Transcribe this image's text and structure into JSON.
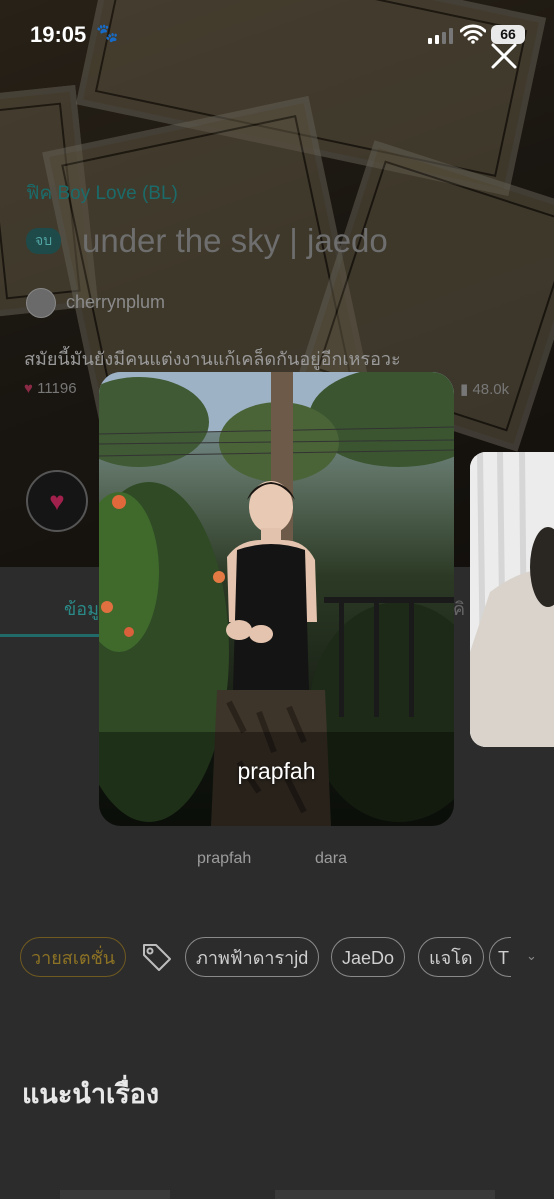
{
  "status_bar": {
    "time": "19:05",
    "battery": "66"
  },
  "story": {
    "genre": "ฟิค Boy Love (BL)",
    "status_badge": "จบ",
    "title": "under the sky | jaedo",
    "author": "cherrynplum",
    "description": "สมัยนี้มันยังมีคนแต่งงานแก้เคล็ดกันอยู่อีกเหรอวะ",
    "likes": "11196",
    "reads": "48.0k"
  },
  "tabs": {
    "info": "ข้อมูล",
    "other": "คิ"
  },
  "characters": [
    {
      "name": "prapfah"
    },
    {
      "name": "dara"
    }
  ],
  "tags": [
    "วายสเตชั่น",
    "ภาพฟ้าดาราjd",
    "JaeDo",
    "แจโด",
    "T"
  ],
  "section": {
    "recommend_title": "แนะนำเรื่อง"
  },
  "overlay": {
    "current_label": "prapfah"
  },
  "icons": {
    "close": "close-icon",
    "heart": "heart-icon",
    "tag": "tag-icon",
    "paw": "paw-icon",
    "signal": "cellular-signal-icon",
    "wifi": "wifi-icon",
    "battery": "battery-icon"
  },
  "colors": {
    "accent": "#2a8a88",
    "like": "#a2204c"
  }
}
